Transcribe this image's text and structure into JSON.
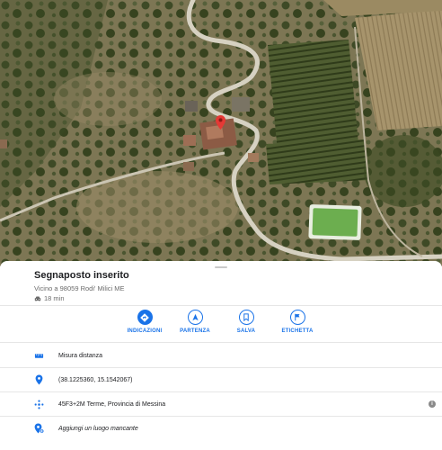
{
  "place": {
    "title": "Segnaposto inserito",
    "subtitle": "Vicino a 98059 Rodi' Milici ME",
    "drive_time": "18 min"
  },
  "actions": [
    {
      "label": "INDICAZIONI",
      "icon": "directions-icon"
    },
    {
      "label": "PARTENZA",
      "icon": "navigation-arrow-icon"
    },
    {
      "label": "SALVA",
      "icon": "bookmark-icon"
    },
    {
      "label": "ETICHETTA",
      "icon": "flag-icon"
    }
  ],
  "details": {
    "measure": "Misura distanza",
    "coordinates": "(38.1225360, 15.1542067)",
    "plus_code": "45F3+2M Terme, Provincia di Messina",
    "add_place": "Aggiungi un luogo mancante"
  },
  "colors": {
    "accent": "#1a73e8",
    "pin": "#e53935"
  }
}
